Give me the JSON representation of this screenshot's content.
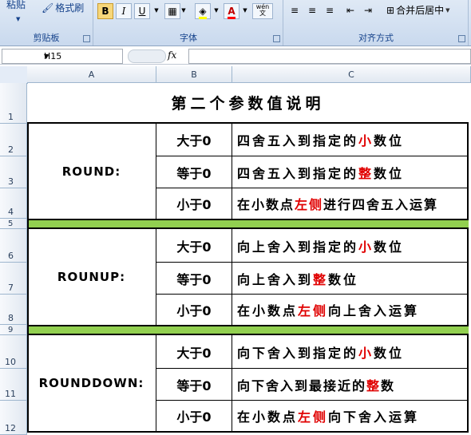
{
  "ribbon": {
    "paste_label": "粘贴",
    "format_painter_label": "格式刷",
    "clipboard_group": "剪贴板",
    "font_group": "字体",
    "align_group": "对齐方式",
    "bold": "B",
    "italic": "I",
    "underline": "U",
    "merge_label": "合并后居中",
    "wen_label": "wén\n文"
  },
  "formula_bar": {
    "name_box": "H15",
    "fx": "fx",
    "formula": ""
  },
  "columns": [
    "A",
    "B",
    "C"
  ],
  "rows": [
    "1",
    "2",
    "3",
    "4",
    "5",
    "6",
    "7",
    "8",
    "9",
    "10",
    "11",
    "12"
  ],
  "title": "第二个参数值说明",
  "groups": [
    {
      "label": "ROUND:",
      "rows": [
        {
          "cond": "大于0",
          "pre": "四舍五入到指定的",
          "red": "小",
          "post": "数位"
        },
        {
          "cond": "等于0",
          "pre": "四舍五入到指定的",
          "red": "整",
          "post": "数位"
        },
        {
          "cond": "小于0",
          "pre": "在小数点",
          "red": "左侧",
          "post": "进行四舍五入运算"
        }
      ]
    },
    {
      "label": "ROUNUP:",
      "rows": [
        {
          "cond": "大于0",
          "pre": "向上舍入到指定的",
          "red": "小",
          "post": "数位"
        },
        {
          "cond": "等于0",
          "pre": "向上舍入到",
          "red": "整",
          "post": "数位"
        },
        {
          "cond": "小于0",
          "pre": "在小数点",
          "red": "左侧",
          "post": "向上舍入运算"
        }
      ]
    },
    {
      "label": "ROUNDDOWN:",
      "rows": [
        {
          "cond": "大于0",
          "pre": "向下舍入到指定的",
          "red": "小",
          "post": "数位"
        },
        {
          "cond": "等于0",
          "pre": "向下舍入到最接近的",
          "red": "整",
          "post": "数"
        },
        {
          "cond": "小于0",
          "pre": "在小数点",
          "red": "左侧",
          "post": "向下舍入运算"
        }
      ]
    }
  ],
  "colors": {
    "separator": "#92d050",
    "highlight": "#e00000"
  }
}
